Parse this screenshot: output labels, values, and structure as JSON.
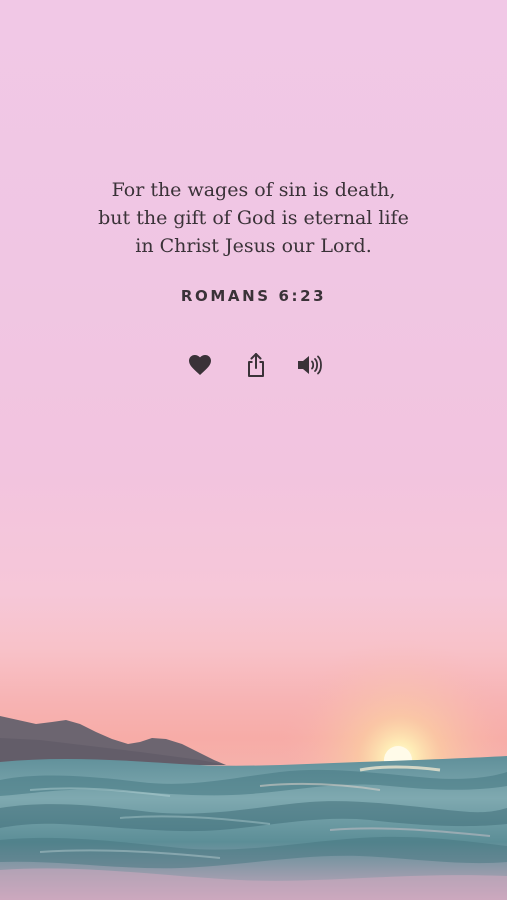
{
  "verse": {
    "text": "For the wages of sin is death,\nbut the gift of God is eternal life\nin Christ Jesus our Lord.",
    "reference": "ROMANS 6:23"
  },
  "actions": [
    {
      "icon": "heart-icon"
    },
    {
      "icon": "share-icon"
    },
    {
      "icon": "speaker-icon"
    }
  ],
  "colors": {
    "text": "#3a3238",
    "sky_top": "#f1c8e6",
    "horizon": "#f7aca7",
    "sun": "#fff3c4",
    "water": "#4f8a93"
  }
}
